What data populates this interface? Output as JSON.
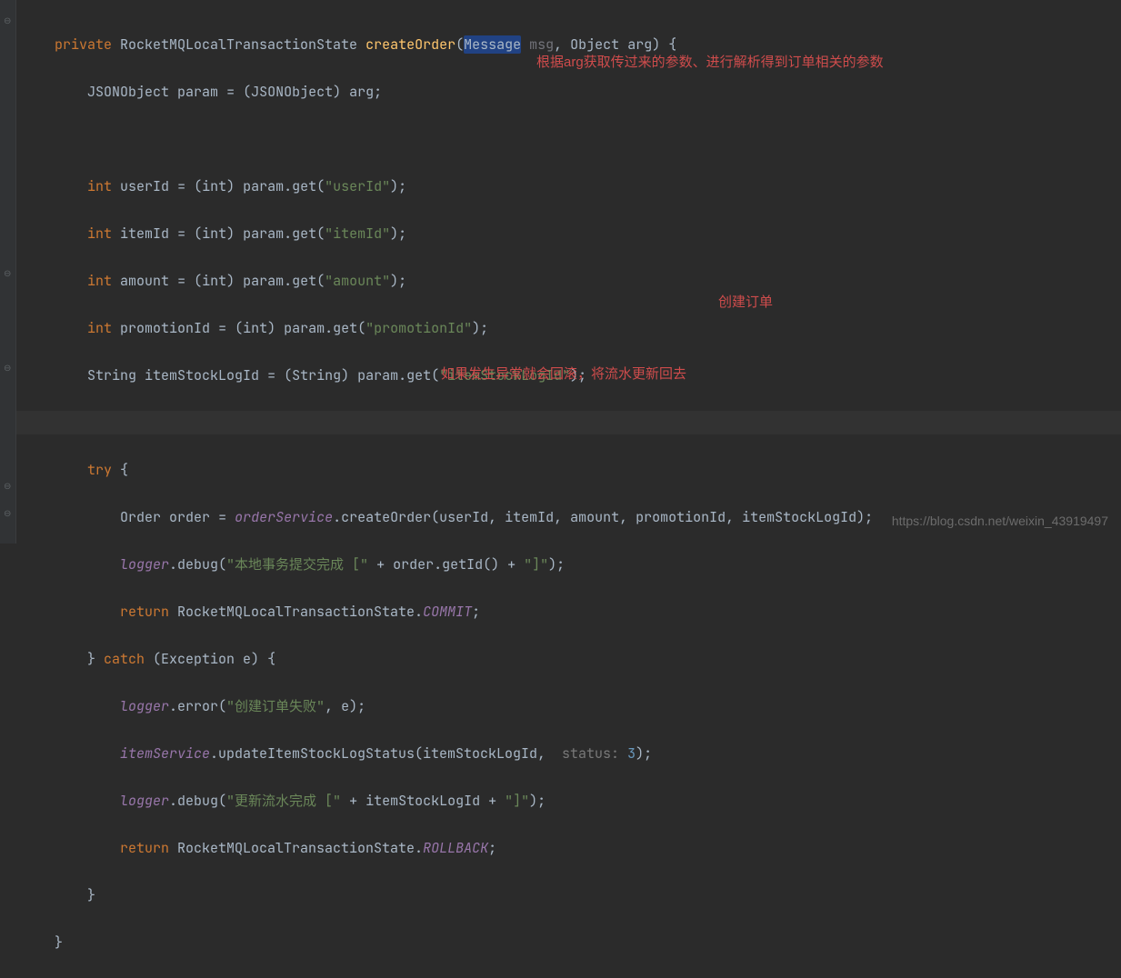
{
  "code": {
    "l1": {
      "kw": "private",
      "type1": "RocketMQLocalTransactionState",
      "fn": "createOrder",
      "p1type": "Message",
      "p1name": "msg",
      "p2type": "Object",
      "p2name": "arg"
    },
    "l2": {
      "type": "JSONObject",
      "var": "param",
      "cast": "(JSONObject)",
      "rhs": "arg;"
    },
    "l4": {
      "kw": "int",
      "var": "userId",
      "cast": "(int)",
      "call": "param.get(",
      "arg": "\"userId\"",
      "end": ");"
    },
    "l5": {
      "kw": "int",
      "var": "itemId",
      "cast": "(int)",
      "call": "param.get(",
      "arg": "\"itemId\"",
      "end": ");"
    },
    "l6": {
      "kw": "int",
      "var": "amount",
      "cast": "(int)",
      "call": "param.get(",
      "arg": "\"amount\"",
      "end": ");"
    },
    "l7": {
      "kw": "int",
      "var": "promotionId",
      "cast": "(int)",
      "call": "param.get(",
      "arg": "\"promotionId\"",
      "end": ");"
    },
    "l8": {
      "type": "String",
      "var": "itemStockLogId",
      "cast": "(String)",
      "call": "param.get(",
      "arg": "\"itemStockLogId\"",
      "end": ");"
    },
    "l10": {
      "kw": "try"
    },
    "l11": {
      "type": "Order",
      "var": "order",
      "svc": "orderService",
      "fn": ".createOrder(userId, itemId, amount, promotionId, itemStockLogId);"
    },
    "l12": {
      "svc": "logger",
      "fn": ".debug(",
      "s1": "\"本地事务提交完成 [\"",
      "mid": " + order.getId() + ",
      "s2": "\"]\"",
      "end": ");"
    },
    "l13": {
      "kw": "return",
      "type": "RocketMQLocalTransactionState.",
      "stat": "COMMIT",
      "end": ";"
    },
    "l14": {
      "kw1": "catch",
      "ex": "(Exception e)"
    },
    "l15": {
      "svc": "logger",
      "fn": ".error(",
      "s1": "\"创建订单失败\"",
      "end": ", e);"
    },
    "l16": {
      "svc": "itemService",
      "fn": ".updateItemStockLogStatus(itemStockLogId,  ",
      "hint": "status:",
      "num": "3",
      "end": ");"
    },
    "l17": {
      "svc": "logger",
      "fn": ".debug(",
      "s1": "\"更新流水完成 [\"",
      "mid": " + itemStockLogId + ",
      "s2": "\"]\"",
      "end": ");"
    },
    "l18": {
      "kw": "return",
      "type": "RocketMQLocalTransactionState.",
      "stat": "ROLLBACK",
      "end": ";"
    }
  },
  "annotations": {
    "a1": "根据arg获取传过来的参数、进行解析得到订单相关的参数",
    "a2": "创建订单",
    "a3": "如果发生异常就会回滚，将流水更新回去"
  },
  "watermark": "https://blog.csdn.net/weixin_43919497"
}
